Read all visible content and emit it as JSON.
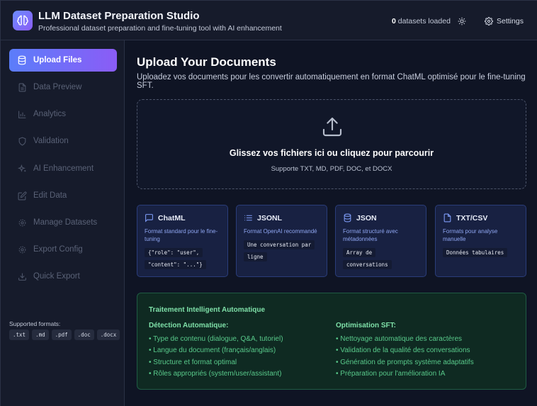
{
  "header": {
    "title": "LLM Dataset Preparation Studio",
    "subtitle": "Professional dataset preparation and fine-tuning tool with AI enhancement",
    "datasets_count": "0",
    "datasets_suffix": "datasets loaded",
    "settings_label": "Settings"
  },
  "sidebar": {
    "items": [
      {
        "label": "Upload Files",
        "icon": "database-icon",
        "active": true
      },
      {
        "label": "Data Preview",
        "icon": "file-text-icon",
        "active": false
      },
      {
        "label": "Analytics",
        "icon": "bar-chart-icon",
        "active": false
      },
      {
        "label": "Validation",
        "icon": "shield-icon",
        "active": false
      },
      {
        "label": "AI Enhancement",
        "icon": "sparkles-icon",
        "active": false
      },
      {
        "label": "Edit Data",
        "icon": "edit-icon",
        "active": false
      },
      {
        "label": "Manage Datasets",
        "icon": "gear-icon",
        "active": false
      },
      {
        "label": "Export Config",
        "icon": "gear-icon",
        "active": false
      },
      {
        "label": "Quick Export",
        "icon": "download-icon",
        "active": false
      }
    ],
    "formats_label": "Supported formats:",
    "formats": [
      ".txt",
      ".md",
      ".pdf",
      ".doc",
      ".docx"
    ]
  },
  "main": {
    "title": "Upload Your Documents",
    "description": "Uploadez vos documents pour les convertir automatiquement en format ChatML optimisé pour le fine-tuning SFT.",
    "dropzone": {
      "title": "Glissez vos fichiers ici ou cliquez pour parcourir",
      "subtitle": "Supporte TXT, MD, PDF, DOC, et DOCX"
    },
    "cards": [
      {
        "name": "ChatML",
        "icon": "message-square-icon",
        "desc": "Format standard pour le fine-tuning",
        "code1": "{\"role\": \"user\",",
        "code2": "\"content\": \"...\"}"
      },
      {
        "name": "JSONL",
        "icon": "list-icon",
        "desc": "Format OpenAI recommandé",
        "code1": "Une conversation par",
        "code2": "ligne"
      },
      {
        "name": "JSON",
        "icon": "database-icon",
        "desc": "Format structuré avec métadonnées",
        "code1": "Array de",
        "code2": "conversations"
      },
      {
        "name": "TXT/CSV",
        "icon": "file-icon",
        "desc": "Formats pour analyse manuelle",
        "code1": "Données tabulaires",
        "code2": ""
      }
    ],
    "ai_panel": {
      "title": "Traitement Intelligent Automatique",
      "left_title": "Détection Automatique:",
      "left_items": [
        "• Type de contenu (dialogue, Q&A, tutoriel)",
        "• Langue du document (français/anglais)",
        "• Structure et format optimal",
        "• Rôles appropriés (system/user/assistant)"
      ],
      "right_title": "Optimisation SFT:",
      "right_items": [
        "• Nettoyage automatique des caractères",
        "• Validation de la qualité des conversations",
        "• Génération de prompts système adaptatifs",
        "• Préparation pour l'amélioration IA"
      ]
    }
  },
  "colors": {
    "accent_start": "#5b7dfa",
    "accent_end": "#8b5cf6",
    "card_border": "#2a3d7a",
    "ai_green": "#7fe1a9"
  }
}
